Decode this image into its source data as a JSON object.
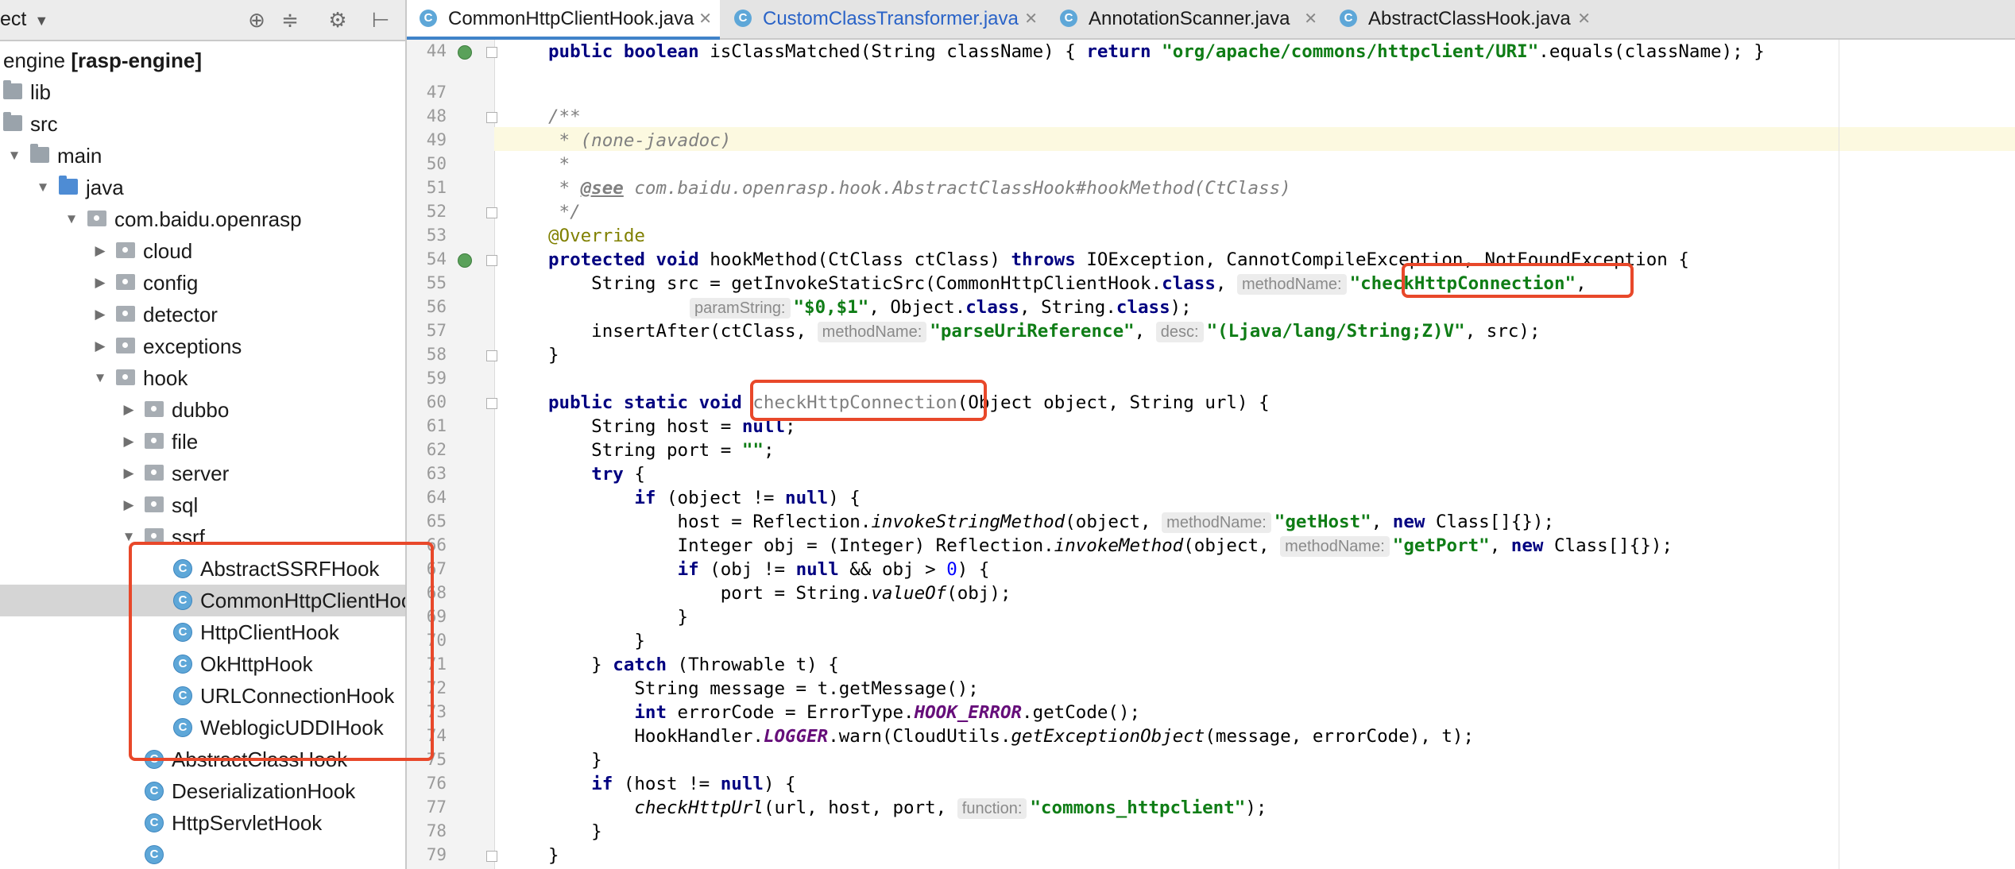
{
  "project_panel": {
    "title": "ect",
    "toolbar_icons": [
      "target-icon",
      "collapse-icon",
      "gear-icon",
      "pin-icon"
    ],
    "tree": [
      {
        "label_plain": "engine ",
        "label_bold": "[rasp-engine]",
        "kind": "module",
        "depth": 0
      },
      {
        "label": "lib",
        "kind": "folder",
        "depth": 0
      },
      {
        "label": "src",
        "kind": "folder",
        "depth": 0
      },
      {
        "label": "main",
        "kind": "folder",
        "depth": 1,
        "expanded": true
      },
      {
        "label": "java",
        "kind": "source-folder",
        "depth": 2,
        "expanded": true
      },
      {
        "label": "com.baidu.openrasp",
        "kind": "package",
        "depth": 3,
        "expanded": true
      },
      {
        "label": "cloud",
        "kind": "package",
        "depth": 4,
        "expanded": false
      },
      {
        "label": "config",
        "kind": "package",
        "depth": 4,
        "expanded": false
      },
      {
        "label": "detector",
        "kind": "package",
        "depth": 4,
        "expanded": false
      },
      {
        "label": "exceptions",
        "kind": "package",
        "depth": 4,
        "expanded": false
      },
      {
        "label": "hook",
        "kind": "package",
        "depth": 4,
        "expanded": true
      },
      {
        "label": "dubbo",
        "kind": "package",
        "depth": 5,
        "expanded": false
      },
      {
        "label": "file",
        "kind": "package",
        "depth": 5,
        "expanded": false
      },
      {
        "label": "server",
        "kind": "package",
        "depth": 5,
        "expanded": false
      },
      {
        "label": "sql",
        "kind": "package",
        "depth": 5,
        "expanded": false
      },
      {
        "label": "ssrf",
        "kind": "package",
        "depth": 5,
        "expanded": true
      },
      {
        "label": "AbstractSSRFHook",
        "kind": "class",
        "depth": 6
      },
      {
        "label": "CommonHttpClientHook",
        "kind": "class",
        "depth": 6,
        "selected": true
      },
      {
        "label": "HttpClientHook",
        "kind": "class",
        "depth": 6
      },
      {
        "label": "OkHttpHook",
        "kind": "class",
        "depth": 6
      },
      {
        "label": "URLConnectionHook",
        "kind": "class",
        "depth": 6
      },
      {
        "label": "WeblogicUDDIHook",
        "kind": "class",
        "depth": 6
      },
      {
        "label": "AbstractClassHook",
        "kind": "class",
        "depth": 5
      },
      {
        "label": "DeserializationHook",
        "kind": "class",
        "depth": 5
      },
      {
        "label": "HttpServletHook",
        "kind": "class",
        "depth": 5
      },
      {
        "label": "",
        "kind": "class",
        "depth": 5
      }
    ]
  },
  "tabs": [
    {
      "label": "CommonHttpClientHook.java",
      "active": true
    },
    {
      "label": "CustomClassTransformer.java",
      "active": false
    },
    {
      "label": "AnnotationScanner.java",
      "active": false
    },
    {
      "label": "AbstractClassHook.java",
      "active": false
    }
  ],
  "editor": {
    "line_numbers": [
      "44",
      "47",
      "48",
      "49",
      "50",
      "51",
      "52",
      "53",
      "54",
      "55",
      "56",
      "57",
      "58",
      "59",
      "60",
      "61",
      "62",
      "63",
      "64",
      "65",
      "66",
      "67",
      "68",
      "69",
      "70",
      "71",
      "72",
      "73",
      "74",
      "75",
      "76",
      "77",
      "78",
      "79"
    ],
    "code": {
      "l44_a": "public boolean ",
      "l44_b": "isClassMatched(String className) { ",
      "l44_c": "return ",
      "l44_d": "\"org/apache/commons/httpclient/URI\"",
      "l44_e": ".equals(className); }",
      "l48": "/**",
      "l49": " * (none-javadoc)",
      "l50": " *",
      "l51_a": " * ",
      "l51_tag": "@see",
      "l51_b": " com.baidu.openrasp.hook.AbstractClassHook#hookMethod(CtClass)",
      "l52": " */",
      "l53": "@Override",
      "l54_a": "protected void ",
      "l54_b": "hookMethod(CtClass ctClass) ",
      "l54_c": "throws ",
      "l54_d": "IOException, CannotCompileException, NotFoundException {",
      "l55_a": "    String src = getInvokeStaticSrc(CommonHttpClientHook.",
      "l55_b": "class",
      "l55_c": ", ",
      "l55_hint": "methodName:",
      "l55_d": "\"checkHttpConnection\"",
      "l55_e": ",",
      "l56_hint": "paramString:",
      "l56_a": "\"$0,$1\"",
      "l56_b": ", Object.",
      "l56_c": "class",
      "l56_d": ", String.",
      "l56_e": "class",
      "l56_f": ");",
      "l57_a": "    insertAfter(ctClass, ",
      "l57_hint1": "methodName:",
      "l57_b": "\"parseUriReference\"",
      "l57_c": ", ",
      "l57_hint2": "desc:",
      "l57_d": "\"(Ljava/lang/String;Z)V\"",
      "l57_e": ", src);",
      "l58": "}",
      "l60_a": "public static void ",
      "l60_b": "checkHttpConnection",
      "l60_c": "(Object object, String url) {",
      "l61_a": "    String host = ",
      "l61_b": "null",
      "l61_c": ";",
      "l62_a": "    String port = ",
      "l62_b": "\"\"",
      "l62_c": ";",
      "l63_a": "    ",
      "l63_b": "try",
      "l63_c": " {",
      "l64_a": "        ",
      "l64_b": "if",
      "l64_c": " (object != ",
      "l64_d": "null",
      "l64_e": ") {",
      "l65_a": "            host = Reflection.",
      "l65_b": "invokeStringMethod",
      "l65_c": "(object, ",
      "l65_hint": "methodName:",
      "l65_d": "\"getHost\"",
      "l65_e": ", ",
      "l65_f": "new",
      "l65_g": " Class[]{});",
      "l66_a": "            Integer obj = (Integer) Reflection.",
      "l66_b": "invokeMethod",
      "l66_c": "(object, ",
      "l66_hint": "methodName:",
      "l66_d": "\"getPort\"",
      "l66_e": ", ",
      "l66_f": "new",
      "l66_g": " Class[]{});",
      "l67_a": "            ",
      "l67_b": "if",
      "l67_c": " (obj != ",
      "l67_d": "null",
      "l67_e": " && obj > ",
      "l67_f": "0",
      "l67_g": ") {",
      "l68_a": "                port = String.",
      "l68_b": "valueOf",
      "l68_c": "(obj);",
      "l69": "            }",
      "l70": "        }",
      "l71_a": "    } ",
      "l71_b": "catch",
      "l71_c": " (Throwable t) {",
      "l72": "        String message = t.getMessage();",
      "l73_a": "        ",
      "l73_b": "int",
      "l73_c": " errorCode = ErrorType.",
      "l73_d": "HOOK_ERROR",
      "l73_e": ".getCode();",
      "l74_a": "        HookHandler.",
      "l74_b": "LOGGER",
      "l74_c": ".warn(CloudUtils.",
      "l74_d": "getExceptionObject",
      "l74_e": "(message, errorCode), t);",
      "l75": "    }",
      "l76_a": "    ",
      "l76_b": "if",
      "l76_c": " (host != ",
      "l76_d": "null",
      "l76_e": ") {",
      "l77_a": "        ",
      "l77_b": "checkHttpUrl",
      "l77_c": "(url, host, port, ",
      "l77_hint": "function:",
      "l77_d": "\"commons_httpclient\"",
      "l77_e": ");",
      "l78": "    }",
      "l79": "}"
    }
  },
  "colors": {
    "keyword": "#000080",
    "string": "#0f7d16",
    "comment": "#808080",
    "annotation": "#808000",
    "highlight_box": "#e8482a",
    "tab_underline": "#4083c9"
  }
}
